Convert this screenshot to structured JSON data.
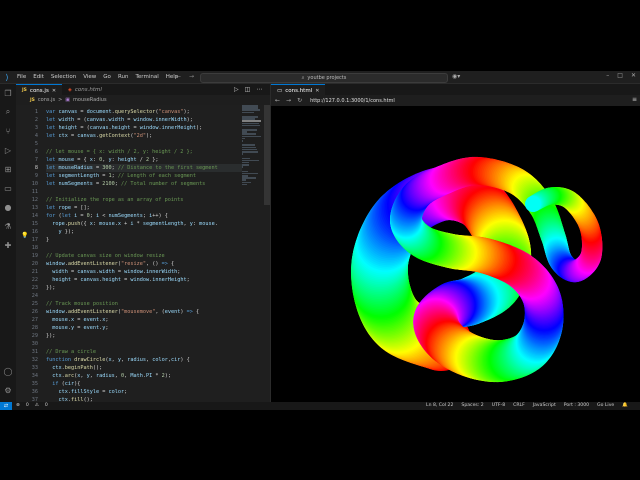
{
  "menu": [
    "File",
    "Edit",
    "Selection",
    "View",
    "Go",
    "Run",
    "Terminal",
    "Help"
  ],
  "search": {
    "text": "youtbe projects"
  },
  "tabs": [
    {
      "label": "cons.js",
      "badge": "JS",
      "active": true
    },
    {
      "label": "cons.html",
      "badge": "",
      "active": false
    }
  ],
  "breadcrumb": {
    "file": "cons.js",
    "badge": "JS",
    "sep": ">",
    "symbol": "mouseRadius"
  },
  "editor": {
    "line_numbers": [
      "1",
      "2",
      "3",
      "4",
      "5",
      "6",
      "7",
      "8",
      "9",
      "10",
      "11",
      "12",
      "13",
      "14",
      "15",
      "16",
      "17",
      "18",
      "19",
      "20",
      "21",
      "22",
      "23",
      "24",
      "25",
      "26",
      "27",
      "28",
      "29",
      "30",
      "31",
      "32",
      "33",
      "34",
      "35",
      "36",
      "37"
    ],
    "current_line_index": 7,
    "lines": [
      [
        [
          "k",
          "var "
        ],
        [
          "v",
          "canvas"
        ],
        [
          "p",
          " = "
        ],
        [
          "v",
          "document"
        ],
        [
          "p",
          "."
        ],
        [
          "f",
          "querySelector"
        ],
        [
          "p",
          "("
        ],
        [
          "s",
          "\"canvas\""
        ],
        [
          "p",
          ");"
        ]
      ],
      [
        [
          "k",
          "let "
        ],
        [
          "v",
          "width"
        ],
        [
          "p",
          " = ("
        ],
        [
          "v",
          "canvas"
        ],
        [
          "p",
          "."
        ],
        [
          "v",
          "width"
        ],
        [
          "p",
          " = "
        ],
        [
          "v",
          "window"
        ],
        [
          "p",
          "."
        ],
        [
          "v",
          "innerWidth"
        ],
        [
          "p",
          ");"
        ]
      ],
      [
        [
          "k",
          "let "
        ],
        [
          "v",
          "height"
        ],
        [
          "p",
          " = ("
        ],
        [
          "v",
          "canvas"
        ],
        [
          "p",
          "."
        ],
        [
          "v",
          "height"
        ],
        [
          "p",
          " = "
        ],
        [
          "v",
          "window"
        ],
        [
          "p",
          "."
        ],
        [
          "v",
          "innerHeight"
        ],
        [
          "p",
          ");"
        ]
      ],
      [
        [
          "k",
          "let "
        ],
        [
          "v",
          "ctx"
        ],
        [
          "p",
          " = "
        ],
        [
          "v",
          "canvas"
        ],
        [
          "p",
          "."
        ],
        [
          "f",
          "getContext"
        ],
        [
          "p",
          "("
        ],
        [
          "s",
          "\"2d\""
        ],
        [
          "p",
          ");"
        ]
      ],
      [],
      [
        [
          "c",
          "// let mouse = { x: width / 2, y: height / 2 };"
        ]
      ],
      [
        [
          "k",
          "let "
        ],
        [
          "v",
          "mouse"
        ],
        [
          "p",
          " = { "
        ],
        [
          "v",
          "x"
        ],
        [
          "p",
          ": "
        ],
        [
          "n",
          "0"
        ],
        [
          "p",
          ", "
        ],
        [
          "v",
          "y"
        ],
        [
          "p",
          ": "
        ],
        [
          "v",
          "height"
        ],
        [
          "p",
          " / "
        ],
        [
          "n",
          "2"
        ],
        [
          "p",
          " };"
        ]
      ],
      [
        [
          "k",
          "let "
        ],
        [
          "v",
          "mouseRadius"
        ],
        [
          "p",
          " = "
        ],
        [
          "n",
          "300"
        ],
        [
          "p",
          "; "
        ],
        [
          "c",
          "// Distance to the first segment"
        ]
      ],
      [
        [
          "k",
          "let "
        ],
        [
          "v",
          "segmentLength"
        ],
        [
          "p",
          " = "
        ],
        [
          "n",
          "1"
        ],
        [
          "p",
          "; "
        ],
        [
          "c",
          "// Length of each segment"
        ]
      ],
      [
        [
          "k",
          "let "
        ],
        [
          "v",
          "numSegments"
        ],
        [
          "p",
          " = "
        ],
        [
          "n",
          "2100"
        ],
        [
          "p",
          "; "
        ],
        [
          "c",
          "// Total number of segments"
        ]
      ],
      [],
      [
        [
          "c",
          "// Initialize the rope as an array of points"
        ]
      ],
      [
        [
          "k",
          "let "
        ],
        [
          "v",
          "rope"
        ],
        [
          "p",
          " = [];"
        ]
      ],
      [
        [
          "k",
          "for "
        ],
        [
          "p",
          "("
        ],
        [
          "k",
          "let "
        ],
        [
          "v",
          "i"
        ],
        [
          "p",
          " = "
        ],
        [
          "n",
          "0"
        ],
        [
          "p",
          "; "
        ],
        [
          "v",
          "i"
        ],
        [
          "p",
          " < "
        ],
        [
          "v",
          "numSegments"
        ],
        [
          "p",
          "; "
        ],
        [
          "v",
          "i"
        ],
        [
          "p",
          "++) {"
        ]
      ],
      [
        [
          "p",
          "  "
        ],
        [
          "v",
          "rope"
        ],
        [
          "p",
          "."
        ],
        [
          "f",
          "push"
        ],
        [
          "p",
          "({ "
        ],
        [
          "v",
          "x"
        ],
        [
          "p",
          ": "
        ],
        [
          "v",
          "mouse"
        ],
        [
          "p",
          "."
        ],
        [
          "v",
          "x"
        ],
        [
          "p",
          " + "
        ],
        [
          "v",
          "i"
        ],
        [
          "p",
          " * "
        ],
        [
          "v",
          "segmentLength"
        ],
        [
          "p",
          ", "
        ],
        [
          "v",
          "y"
        ],
        [
          "p",
          ": "
        ],
        [
          "v",
          "mouse"
        ],
        [
          "p",
          "."
        ]
      ],
      [
        [
          "p",
          "    "
        ],
        [
          "v",
          "y"
        ],
        [
          "p",
          " });"
        ]
      ],
      [
        [
          "p",
          "}"
        ]
      ],
      [],
      [
        [
          "c",
          "// Update canvas size on window resize"
        ]
      ],
      [
        [
          "v",
          "window"
        ],
        [
          "p",
          "."
        ],
        [
          "f",
          "addEventListener"
        ],
        [
          "p",
          "("
        ],
        [
          "s",
          "\"resize\""
        ],
        [
          "p",
          ", () "
        ],
        [
          "k",
          "=>"
        ],
        [
          "p",
          " {"
        ]
      ],
      [
        [
          "p",
          "  "
        ],
        [
          "v",
          "width"
        ],
        [
          "p",
          " = "
        ],
        [
          "v",
          "canvas"
        ],
        [
          "p",
          "."
        ],
        [
          "v",
          "width"
        ],
        [
          "p",
          " = "
        ],
        [
          "v",
          "window"
        ],
        [
          "p",
          "."
        ],
        [
          "v",
          "innerWidth"
        ],
        [
          "p",
          ";"
        ]
      ],
      [
        [
          "p",
          "  "
        ],
        [
          "v",
          "height"
        ],
        [
          "p",
          " = "
        ],
        [
          "v",
          "canvas"
        ],
        [
          "p",
          "."
        ],
        [
          "v",
          "height"
        ],
        [
          "p",
          " = "
        ],
        [
          "v",
          "window"
        ],
        [
          "p",
          "."
        ],
        [
          "v",
          "innerHeight"
        ],
        [
          "p",
          ";"
        ]
      ],
      [
        [
          "p",
          "});"
        ]
      ],
      [],
      [
        [
          "c",
          "// Track mouse position"
        ]
      ],
      [
        [
          "v",
          "window"
        ],
        [
          "p",
          "."
        ],
        [
          "f",
          "addEventListener"
        ],
        [
          "p",
          "("
        ],
        [
          "s",
          "\"mousemove\""
        ],
        [
          "p",
          ", ("
        ],
        [
          "v",
          "event"
        ],
        [
          "p",
          ") "
        ],
        [
          "k",
          "=>"
        ],
        [
          "p",
          " {"
        ]
      ],
      [
        [
          "p",
          "  "
        ],
        [
          "v",
          "mouse"
        ],
        [
          "p",
          "."
        ],
        [
          "v",
          "x"
        ],
        [
          "p",
          " = "
        ],
        [
          "v",
          "event"
        ],
        [
          "p",
          "."
        ],
        [
          "v",
          "x"
        ],
        [
          "p",
          ";"
        ]
      ],
      [
        [
          "p",
          "  "
        ],
        [
          "v",
          "mouse"
        ],
        [
          "p",
          "."
        ],
        [
          "v",
          "y"
        ],
        [
          "p",
          " = "
        ],
        [
          "v",
          "event"
        ],
        [
          "p",
          "."
        ],
        [
          "v",
          "y"
        ],
        [
          "p",
          ";"
        ]
      ],
      [
        [
          "p",
          "});"
        ]
      ],
      [],
      [
        [
          "c",
          "// Draw a circle"
        ]
      ],
      [
        [
          "k",
          "function "
        ],
        [
          "f",
          "drawCircle"
        ],
        [
          "p",
          "("
        ],
        [
          "v",
          "x"
        ],
        [
          "p",
          ", "
        ],
        [
          "v",
          "y"
        ],
        [
          "p",
          ", "
        ],
        [
          "v",
          "radius"
        ],
        [
          "p",
          ", "
        ],
        [
          "v",
          "color"
        ],
        [
          "p",
          ","
        ],
        [
          "v",
          "cir"
        ],
        [
          "p",
          ") {"
        ]
      ],
      [
        [
          "p",
          "  "
        ],
        [
          "v",
          "ctx"
        ],
        [
          "p",
          "."
        ],
        [
          "f",
          "beginPath"
        ],
        [
          "p",
          "();"
        ]
      ],
      [
        [
          "p",
          "  "
        ],
        [
          "v",
          "ctx"
        ],
        [
          "p",
          "."
        ],
        [
          "f",
          "arc"
        ],
        [
          "p",
          "("
        ],
        [
          "v",
          "x"
        ],
        [
          "p",
          ", "
        ],
        [
          "v",
          "y"
        ],
        [
          "p",
          ", "
        ],
        [
          "v",
          "radius"
        ],
        [
          "p",
          ", "
        ],
        [
          "n",
          "0"
        ],
        [
          "p",
          ", "
        ],
        [
          "v",
          "Math"
        ],
        [
          "p",
          "."
        ],
        [
          "v",
          "PI"
        ],
        [
          "p",
          " * "
        ],
        [
          "n",
          "2"
        ],
        [
          "p",
          ");"
        ]
      ],
      [
        [
          "p",
          "  "
        ],
        [
          "k",
          "if "
        ],
        [
          "p",
          "("
        ],
        [
          "v",
          "cir"
        ],
        [
          "p",
          ")"
        ],
        [
          "p",
          "{"
        ]
      ],
      [
        [
          "p",
          "    "
        ],
        [
          "v",
          "ctx"
        ],
        [
          "p",
          "."
        ],
        [
          "v",
          "fillStyle"
        ],
        [
          "p",
          " = "
        ],
        [
          "v",
          "color"
        ],
        [
          "p",
          ";"
        ]
      ],
      [
        [
          "p",
          "    "
        ],
        [
          "v",
          "ctx"
        ],
        [
          "p",
          "."
        ],
        [
          "f",
          "fill"
        ],
        [
          "p",
          "();"
        ]
      ]
    ]
  },
  "browser": {
    "tab_label": "cons.html",
    "url": "http://127.0.0.1:3000/1/cons.html"
  },
  "status": {
    "errors": "0",
    "warnings": "0",
    "position": "Ln 8, Col 22",
    "spaces": "Spaces: 2",
    "encoding": "UTF-8",
    "eol": "CRLF",
    "language": "JavaScript",
    "port": "Port : 3000",
    "golive": "Go Live"
  },
  "colors": {
    "keyword": "#569cd6",
    "variable": "#9cdcfe",
    "function": "#dcdcaa",
    "string": "#ce9178",
    "number": "#b5cea8",
    "comment": "#6a9955",
    "punct": "#d4d4d4",
    "accent": "#0078d4"
  }
}
